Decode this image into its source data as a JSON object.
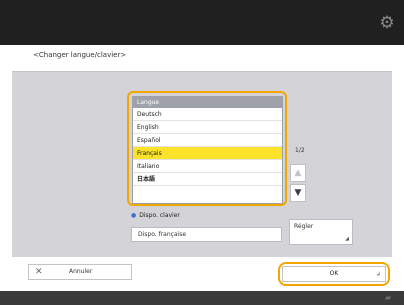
{
  "header": {
    "settings_icon": "gear-icon"
  },
  "title": "<Changer langue/clavier>",
  "language_list": {
    "header": "Langue",
    "items": [
      {
        "label": "Deutsch",
        "selected": false
      },
      {
        "label": "English",
        "selected": false
      },
      {
        "label": "Español",
        "selected": false
      },
      {
        "label": "Français",
        "selected": true
      },
      {
        "label": "Italiano",
        "selected": false
      },
      {
        "label": "日本語",
        "selected": false
      }
    ],
    "page_indicator": "1/2",
    "scroll_up_icon": "arrow-up-icon",
    "scroll_down_icon": "arrow-down-icon"
  },
  "keyboard": {
    "label": "Dispo. clavier",
    "value": "Dispo. française",
    "settings_button": "Régler"
  },
  "buttons": {
    "cancel": "Annuler",
    "ok": "OK"
  },
  "colors": {
    "accent": "#f2a600",
    "selection": "#fde22a",
    "topbar": "#202020",
    "panel": "#d4d4d8"
  }
}
